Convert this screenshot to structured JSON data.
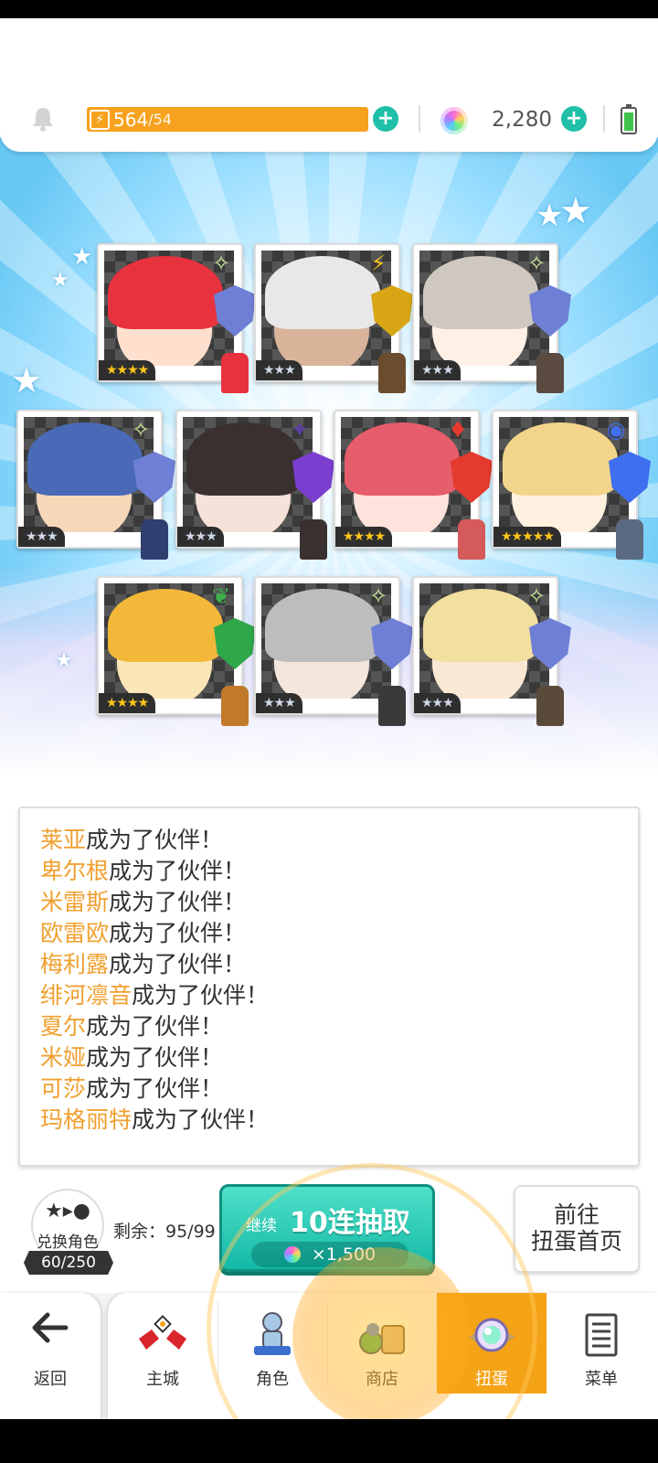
{
  "status": {
    "stamina_current": "564",
    "stamina_max": "/54",
    "gems": "2,280"
  },
  "characters": [
    {
      "stars": "★★★★",
      "element": "✧",
      "tier": "gold",
      "hair": "#e8323e",
      "face": "#ffe0cf",
      "shield": "#6f7fd6",
      "chibi": "#e8323e"
    },
    {
      "stars": "★★★",
      "element": "⚡",
      "tier": "silver",
      "hair": "#e8e8e8",
      "face": "#d9b39a",
      "shield": "#d8a614",
      "chibi": "#6b4c2e"
    },
    {
      "stars": "★★★",
      "element": "✧",
      "tier": "silver",
      "hair": "#cfc8c0",
      "face": "#fff0e6",
      "shield": "#6f7fd6",
      "chibi": "#5a4a40"
    },
    {
      "stars": "★★★",
      "element": "✧",
      "tier": "silver",
      "hair": "#4a6ab8",
      "face": "#f5d8b8",
      "shield": "#6f7fd6",
      "chibi": "#2f3f70"
    },
    {
      "stars": "★★★",
      "element": "✦",
      "tier": "silver",
      "hair": "#3a3030",
      "face": "#f6e2d8",
      "shield": "#7a3fd0",
      "chibi": "#3a3030"
    },
    {
      "stars": "★★★★",
      "element": "♦",
      "tier": "gold",
      "hair": "#e65d6b",
      "face": "#ffe2dc",
      "shield": "#e53a2e",
      "chibi": "#d55a5a"
    },
    {
      "stars": "★★★★★",
      "element": "◉",
      "tier": "gold",
      "hair": "#f2d58a",
      "face": "#fff0e0",
      "shield": "#3f6ff0",
      "chibi": "#5a6a80"
    },
    {
      "stars": "★★★★",
      "element": "❦",
      "tier": "gold",
      "hair": "#f3b83a",
      "face": "#fbe6b8",
      "shield": "#2fa84a",
      "chibi": "#c07a2a"
    },
    {
      "stars": "★★★",
      "element": "✧",
      "tier": "silver",
      "hair": "#bdbdbd",
      "face": "#f5e6dc",
      "shield": "#6f7fd6",
      "chibi": "#3a3a3a"
    },
    {
      "stars": "★★★",
      "element": "✧",
      "tier": "silver",
      "hair": "#f2e0a0",
      "face": "#fbe8d4",
      "shield": "#6f7fd6",
      "chibi": "#5a4a3a"
    }
  ],
  "log": {
    "suffix": "成为了伙伴！",
    "names": [
      "莱亚",
      "卑尔根",
      "米雷斯",
      "欧雷欧",
      "梅利露",
      "绯河凛音",
      "夏尔",
      "米娅",
      "可莎",
      "玛格丽特"
    ]
  },
  "exchange": {
    "label": "兑换角色",
    "count": "60/250",
    "remaining": "剩余：95/99"
  },
  "pull_button": {
    "continue_label": "继续",
    "main_label": "10连抽取",
    "cost": "×1,500"
  },
  "go_home": {
    "line1": "前往",
    "line2": "扭蛋首页"
  },
  "nav": {
    "back": "返回",
    "items": [
      "主城",
      "角色",
      "商店",
      "扭蛋",
      "菜单"
    ]
  },
  "colors": {
    "accent_orange": "#f5a316",
    "teal": "#13b9a6",
    "name_highlight": "#f0a030"
  }
}
